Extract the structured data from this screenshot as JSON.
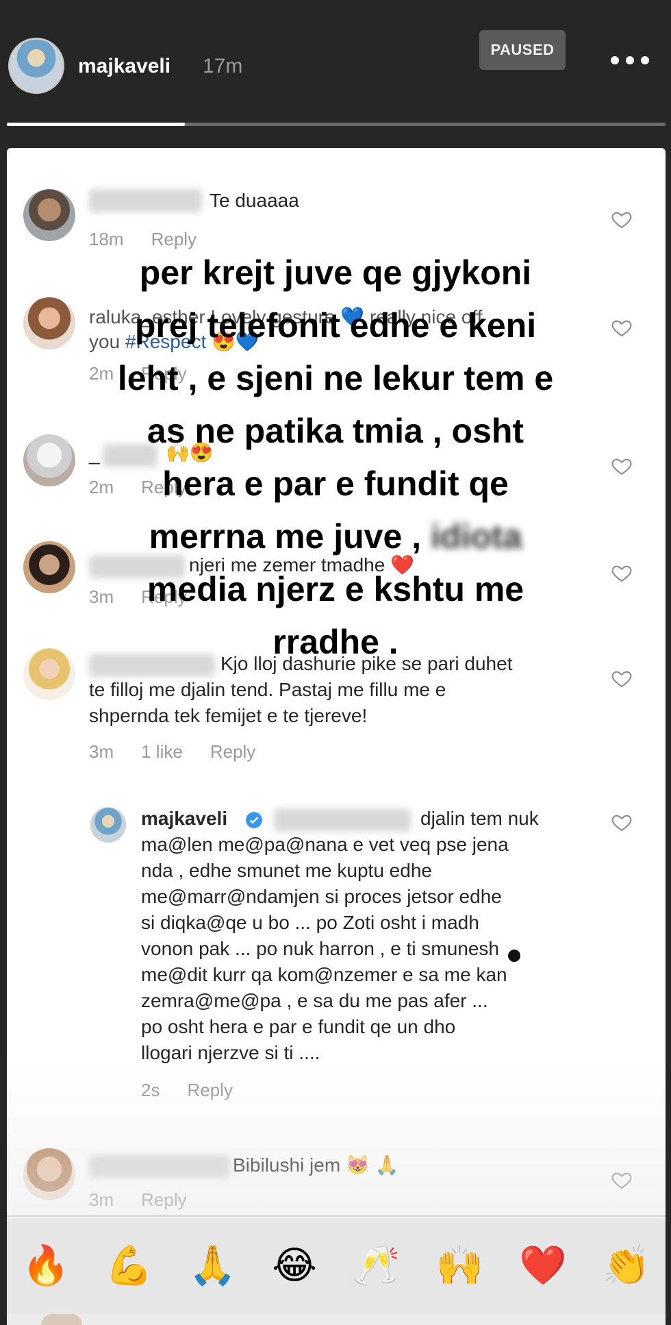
{
  "story": {
    "username": "majkaveli",
    "time": "17m",
    "paused_label": "PAUSED",
    "progress": 0.27
  },
  "comments": [
    {
      "text": "Te duaaaa",
      "time": "18m",
      "reply": "Reply"
    },
    {
      "name": "raluka_esther",
      "text": "Lovely gesture",
      "text2": "really nice off",
      "text3": "you",
      "hashtag": "#Respect",
      "time": "2m",
      "reply": "Reply"
    },
    {
      "name": "_",
      "time": "2m",
      "reply": "Reply"
    },
    {
      "text": "njeri me zemer tmadhe",
      "time": "3m",
      "reply": "Reply"
    },
    {
      "text": "Kjo lloj dashurie pike se pari duhet",
      "text2": "te filloj me djalin tend. Pastaj me fillu me e",
      "text3": "shpernda tek femijet e te tjereve!",
      "time": "3m",
      "likes": "1 like",
      "reply": "Reply"
    }
  ],
  "reply_comment": {
    "username": "majkaveli",
    "lines": [
      "djalin tem nuk",
      "ma@len me@pa@nana e vet veq pse jena",
      "nda , edhe smunet me kuptu edhe",
      "me@marr@ndamjen si proces jetsor edhe",
      "si diqka@qe u bo ... po Zoti osht i madh",
      "vonon pak ... po nuk harron , e ti smunesh",
      "me@dit kurr qa kom@nzemer e sa me kan",
      "zemra@me@pa , e sa du me pas afer ...",
      "po osht hera e par e fundit qe un dho",
      "llogari njerzve si ti ...."
    ],
    "time": "2s",
    "reply": "Reply"
  },
  "last_comment": {
    "text": "Bibilushi jem",
    "time": "3m",
    "reply": "Reply"
  },
  "overlay_lines": [
    "per krejt juve qe gjykoni",
    "prej telefonit edhe e keni",
    "leht , e sjeni ne lekur tem e",
    "as ne patika tmia , osht",
    "hera e par e fundit qe",
    "merrna me juve",
    "media njerz e kshtu me",
    "rradhe ."
  ],
  "overlay_blurred": "idiota",
  "emojis": [
    "🔥",
    "💪",
    "🙏",
    "😂",
    "🥂",
    "🙌",
    "❤️",
    "👏"
  ],
  "colors": {
    "background": "#262626",
    "link": "#285ea8",
    "verified": "#3897f0",
    "heart_red": "#e0243b"
  }
}
